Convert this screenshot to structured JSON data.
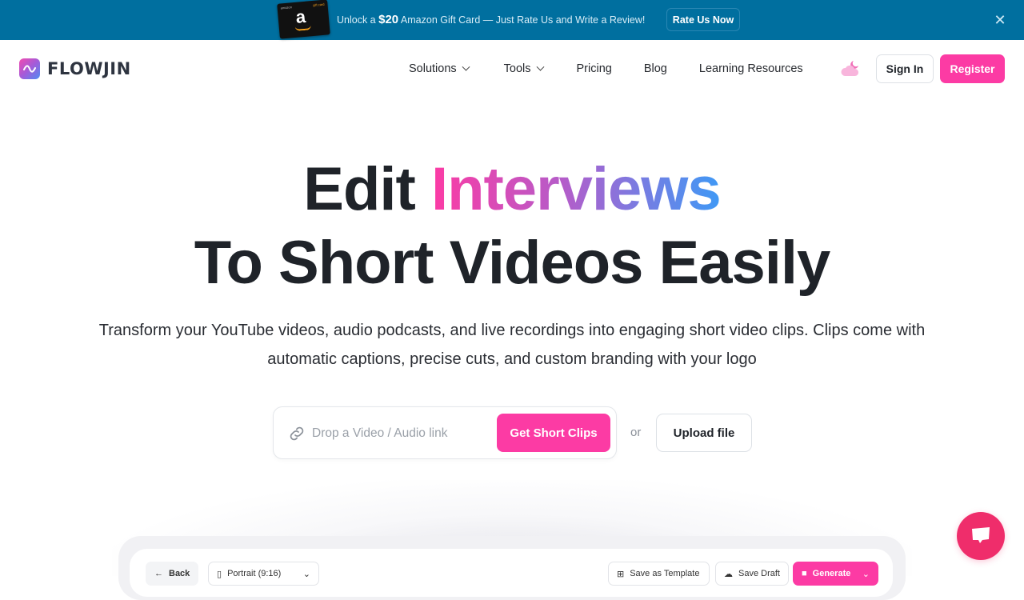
{
  "promo": {
    "prefix": "Unlock a ",
    "amount": "$20",
    "suffix": " Amazon Gift Card — Just Rate Us and Write a Review!",
    "button": "Rate Us Now",
    "close": "✕",
    "gift_card_letter": "a",
    "gift_card_brand": "amazon",
    "gift_card_type": "gift card"
  },
  "header": {
    "logo_text": "FLOWJIN",
    "nav": [
      {
        "label": "Solutions",
        "dropdown": true
      },
      {
        "label": "Tools",
        "dropdown": true
      },
      {
        "label": "Pricing",
        "dropdown": false
      },
      {
        "label": "Blog",
        "dropdown": false
      },
      {
        "label": "Learning Resources",
        "dropdown": false
      }
    ],
    "theme_icon": "cloud-moon-icon",
    "sign_in": "Sign In",
    "register": "Register"
  },
  "hero": {
    "title_plain": "Edit ",
    "title_highlight": "Interviews",
    "title_line2": "To Short Videos Easily",
    "subtitle": "Transform your YouTube videos, audio podcasts, and live recordings into engaging short video clips. Clips come with automatic captions, precise cuts, and custom branding with your logo"
  },
  "input": {
    "placeholder": "Drop a Video / Audio link",
    "value": "",
    "submit": "Get Short Clips",
    "or": "or",
    "upload": "Upload file"
  },
  "preview": {
    "back": "Back",
    "aspect": "Portrait (9:16)",
    "save_template": "Save as Template",
    "save_draft": "Save Draft",
    "generate": "Generate"
  },
  "colors": {
    "brand_pink": "#fc3ba4",
    "banner_blue": "#006f9f",
    "chat_red": "#ef2d6b",
    "gradient_end": "#3f99f5"
  }
}
